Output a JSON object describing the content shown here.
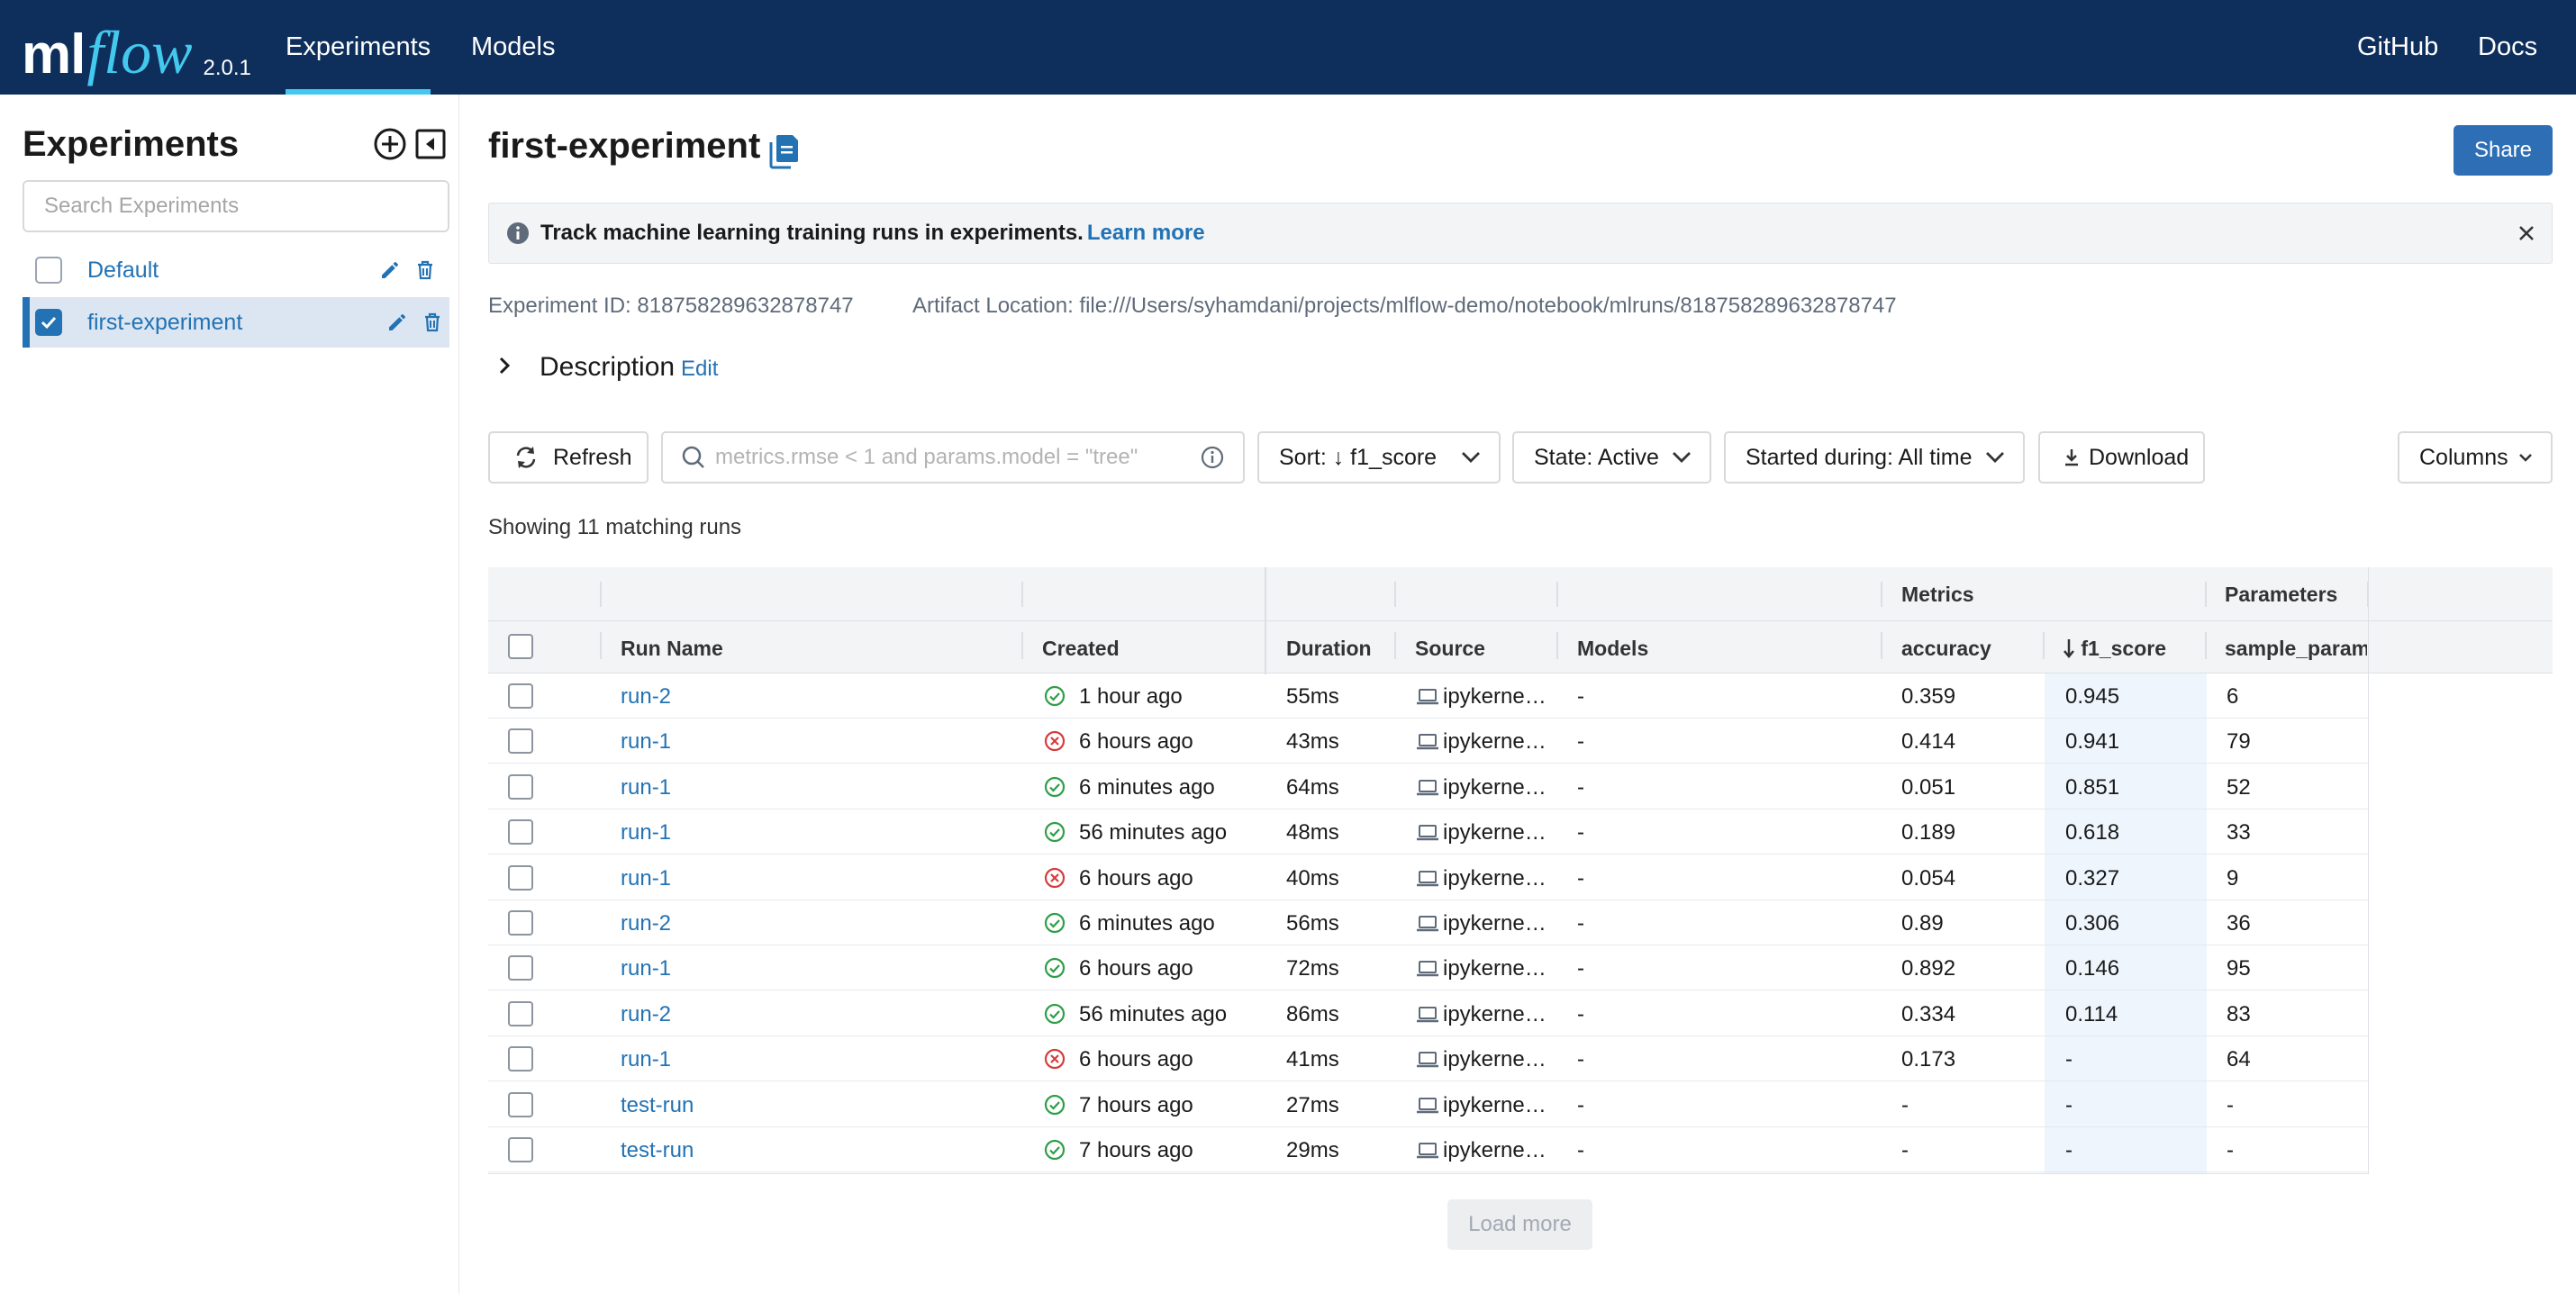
{
  "app": {
    "logo_ml": "ml",
    "logo_flow": "flow",
    "version": "2.0.1",
    "nav": {
      "experiments": "Experiments",
      "models": "Models",
      "github": "GitHub",
      "docs": "Docs"
    },
    "colors": {
      "header_bg": "#0e2f5c",
      "accent": "#43c9ed",
      "link": "#2272b4",
      "primary_button": "#2e6eb5",
      "success": "#2e9e48",
      "error": "#d63c3c"
    }
  },
  "sidebar": {
    "title": "Experiments",
    "search_placeholder": "Search Experiments",
    "experiments": [
      {
        "name": "Default",
        "selected": false
      },
      {
        "name": "first-experiment",
        "selected": true
      }
    ]
  },
  "header": {
    "title": "first-experiment",
    "share_label": "Share"
  },
  "banner": {
    "text": "Track machine learning training runs in experiments.",
    "link": "Learn more"
  },
  "meta": {
    "experiment_id": "Experiment ID: 818758289632878747",
    "artifact_location": "Artifact Location: file:///Users/syhamdani/projects/mlflow-demo/notebook/mlruns/818758289632878747"
  },
  "description": {
    "label": "Description",
    "edit": "Edit"
  },
  "toolbar": {
    "refresh": "Refresh",
    "search_placeholder": "metrics.rmse < 1 and params.model = \"tree\"",
    "sort": "Sort: ↓ f1_score",
    "state": "State: Active",
    "started": "Started during: All time",
    "download": "Download",
    "columns": "Columns"
  },
  "showing": "Showing 11 matching runs",
  "table": {
    "group_headers": {
      "metrics": "Metrics",
      "parameters": "Parameters"
    },
    "columns": {
      "run_name": "Run Name",
      "created": "Created",
      "duration": "Duration",
      "source": "Source",
      "models": "Models",
      "accuracy": "accuracy",
      "f1_score": "f1_score",
      "sample_param": "sample_param"
    },
    "rows": [
      {
        "run": "run-2",
        "status": "success",
        "created": "1 hour ago",
        "duration": "55ms",
        "source": "ipykerne…",
        "models": "-",
        "accuracy": "0.359",
        "f1": "0.945",
        "param": "6"
      },
      {
        "run": "run-1",
        "status": "failed",
        "created": "6 hours ago",
        "duration": "43ms",
        "source": "ipykerne…",
        "models": "-",
        "accuracy": "0.414",
        "f1": "0.941",
        "param": "79"
      },
      {
        "run": "run-1",
        "status": "success",
        "created": "6 minutes ago",
        "duration": "64ms",
        "source": "ipykerne…",
        "models": "-",
        "accuracy": "0.051",
        "f1": "0.851",
        "param": "52"
      },
      {
        "run": "run-1",
        "status": "success",
        "created": "56 minutes ago",
        "duration": "48ms",
        "source": "ipykerne…",
        "models": "-",
        "accuracy": "0.189",
        "f1": "0.618",
        "param": "33"
      },
      {
        "run": "run-1",
        "status": "failed",
        "created": "6 hours ago",
        "duration": "40ms",
        "source": "ipykerne…",
        "models": "-",
        "accuracy": "0.054",
        "f1": "0.327",
        "param": "9"
      },
      {
        "run": "run-2",
        "status": "success",
        "created": "6 minutes ago",
        "duration": "56ms",
        "source": "ipykerne…",
        "models": "-",
        "accuracy": "0.89",
        "f1": "0.306",
        "param": "36"
      },
      {
        "run": "run-1",
        "status": "success",
        "created": "6 hours ago",
        "duration": "72ms",
        "source": "ipykerne…",
        "models": "-",
        "accuracy": "0.892",
        "f1": "0.146",
        "param": "95"
      },
      {
        "run": "run-2",
        "status": "success",
        "created": "56 minutes ago",
        "duration": "86ms",
        "source": "ipykerne…",
        "models": "-",
        "accuracy": "0.334",
        "f1": "0.114",
        "param": "83"
      },
      {
        "run": "run-1",
        "status": "failed",
        "created": "6 hours ago",
        "duration": "41ms",
        "source": "ipykerne…",
        "models": "-",
        "accuracy": "0.173",
        "f1": "-",
        "param": "64"
      },
      {
        "run": "test-run",
        "status": "success",
        "created": "7 hours ago",
        "duration": "27ms",
        "source": "ipykerne…",
        "models": "-",
        "accuracy": "-",
        "f1": "-",
        "param": "-"
      },
      {
        "run": "test-run",
        "status": "success",
        "created": "7 hours ago",
        "duration": "29ms",
        "source": "ipykerne…",
        "models": "-",
        "accuracy": "-",
        "f1": "-",
        "param": "-"
      }
    ]
  },
  "load_more": "Load more"
}
